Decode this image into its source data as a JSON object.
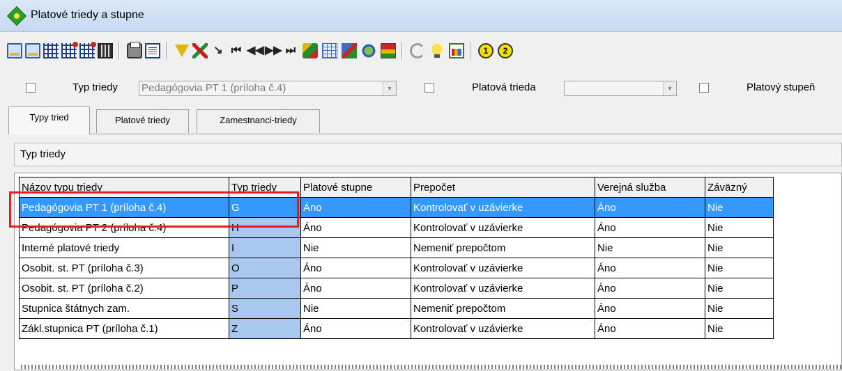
{
  "window": {
    "title": "Platové triedy a stupne",
    "icon": "app-diamond-icon"
  },
  "toolbar": {
    "icons": [
      "new-record-icon",
      "edit-record-icon",
      "grid-view-icon",
      "grid-add-icon",
      "grid-delete-icon",
      "film-icon",
      "print-icon",
      "document-icon",
      "filter-icon",
      "clear-filter-icon",
      "pointer-icon",
      "first-record-icon",
      "previous-record-icon",
      "next-record-icon",
      "last-record-icon",
      "multi-select-icon",
      "table-icon",
      "edit-pen-icon",
      "globe-icon",
      "stack-icon",
      "refresh-icon",
      "idea-bulb-icon",
      "chart-icon",
      "level-1-icon",
      "level-2-icon"
    ],
    "level_1": "1",
    "level_2": "2"
  },
  "filters": {
    "typ_triedy_label": "Typ triedy",
    "typ_triedy_value": "Pedagógovia PT 1 (príloha č.4)",
    "platova_trieda_label": "Platová trieda",
    "platova_trieda_value": "",
    "platovy_stupen_label": "Platový stupeň"
  },
  "tabs": [
    {
      "label": "Typy tried",
      "active": true
    },
    {
      "label": "Platové triedy",
      "active": false
    },
    {
      "label": "Zamestnanci-triedy",
      "active": false
    }
  ],
  "section_title": "Typ triedy",
  "grid": {
    "columns": [
      "Názov typu triedy",
      "Typ triedy",
      "Platové stupne",
      "Prepočet",
      "Verejná služba",
      "Záväzný"
    ],
    "rows": [
      [
        "Pedagógovia PT 1 (príloha č.4)",
        "G",
        "Áno",
        "Kontrolovať v uzávierke",
        "Áno",
        "Nie"
      ],
      [
        "Pedagógovia PT 2 (príloha č.4)",
        "H",
        "Áno",
        "Kontrolovať v uzávierke",
        "Áno",
        "Nie"
      ],
      [
        "Interné platové triedy",
        "I",
        "Nie",
        "Nemeniť prepočtom",
        "Nie",
        "Nie"
      ],
      [
        "Osobit. st. PT (príloha č.3)",
        "O",
        "Áno",
        "Kontrolovať v uzávierke",
        "Áno",
        "Nie"
      ],
      [
        "Osobit. st. PT (príloha č.2)",
        "P",
        "Áno",
        "Kontrolovať v uzávierke",
        "Áno",
        "Nie"
      ],
      [
        "Stupnica štátnych zam.",
        "S",
        "Nie",
        "Nemeniť prepočtom",
        "Áno",
        "Nie"
      ],
      [
        "Zákl.stupnica PT (príloha č.1)",
        "Z",
        "Áno",
        "Kontrolovať v uzávierke",
        "Áno",
        "Nie"
      ]
    ],
    "selected_row": 0
  },
  "colors": {
    "selection": "#3399ff",
    "key_column": "#a8c8ef",
    "highlight": "#e02020"
  }
}
